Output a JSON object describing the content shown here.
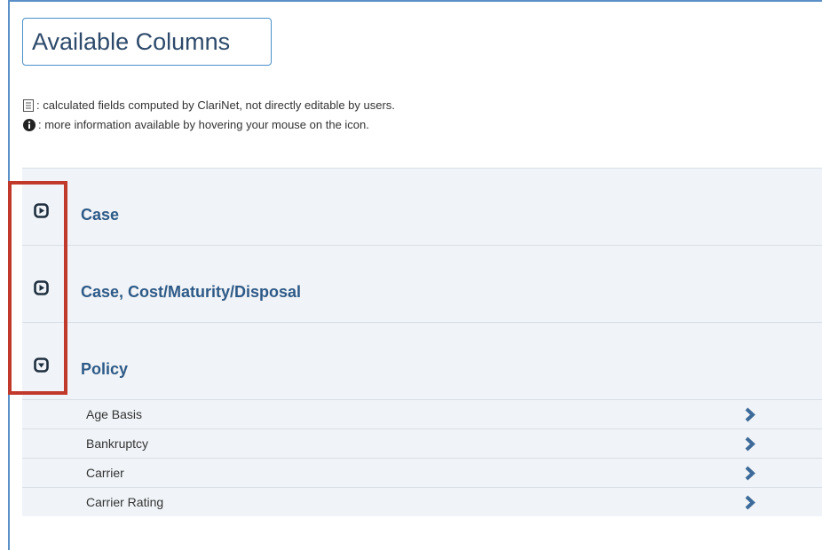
{
  "header": {
    "title": "Available Columns"
  },
  "legend": {
    "calculated": ": calculated fields computed by ClariNet, not directly editable by users.",
    "info": ": more information available by hovering your mouse on the icon."
  },
  "sections": [
    {
      "label": "Case",
      "state": "collapsed",
      "icon": "expand-right-icon"
    },
    {
      "label": "Case, Cost/Maturity/Disposal",
      "state": "collapsed",
      "icon": "expand-right-icon"
    },
    {
      "label": "Policy",
      "state": "expanded",
      "icon": "collapse-down-icon"
    }
  ],
  "policy_items": [
    {
      "label": "Age Basis"
    },
    {
      "label": "Bankruptcy"
    },
    {
      "label": "Carrier"
    },
    {
      "label": "Carrier Rating"
    }
  ],
  "colors": {
    "accent": "#2e5a87",
    "highlight": "#c0392b",
    "row_bg": "#f0f4f8",
    "border": "#4a90c8"
  }
}
